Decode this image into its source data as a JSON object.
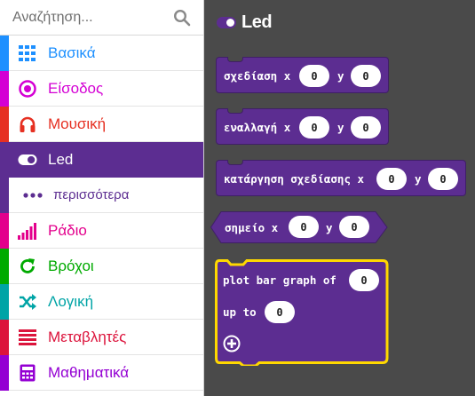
{
  "search": {
    "placeholder": "Αναζήτηση..."
  },
  "colors": {
    "basic": "#1e90ff",
    "input": "#d400d4",
    "music": "#e63022",
    "led": "#5c2d91",
    "radio": "#e3008c",
    "loops": "#00aa00",
    "logic": "#00a4a6",
    "variables": "#dc143c",
    "math": "#9400d3",
    "workspace": "#4a4a4a",
    "selected_outline": "#ffd800"
  },
  "toolbox": {
    "items": [
      {
        "label": "Βασικά",
        "icon": "grid-icon"
      },
      {
        "label": "Είσοδος",
        "icon": "input-circle-icon"
      },
      {
        "label": "Μουσική",
        "icon": "headphones-icon"
      },
      {
        "label": "Led",
        "icon": "toggle-icon"
      },
      {
        "label": "περισσότερα",
        "icon": "more-dots-icon"
      },
      {
        "label": "Ράδιο",
        "icon": "signal-bars-icon"
      },
      {
        "label": "Βρόχοι",
        "icon": "refresh-icon"
      },
      {
        "label": "Λογική",
        "icon": "shuffle-icon"
      },
      {
        "label": "Μεταβλητές",
        "icon": "list-icon"
      },
      {
        "label": "Μαθηματικά",
        "icon": "calculator-icon"
      }
    ]
  },
  "flyout": {
    "title": "Led",
    "blocks": {
      "plot": {
        "label": "σχεδίαση x",
        "y_label": "y",
        "x": "0",
        "y": "0"
      },
      "toggle": {
        "label": "εναλλαγή x",
        "y_label": "y",
        "x": "0",
        "y": "0"
      },
      "unplot": {
        "label": "κατάργηση σχεδίασης x",
        "y_label": "y",
        "x": "0",
        "y": "0"
      },
      "point": {
        "label": "σημείο x",
        "y_label": "y",
        "x": "0",
        "y": "0"
      },
      "bargraph": {
        "label": "plot bar graph of",
        "value": "0",
        "up_to_label": "up to",
        "up_to": "0"
      }
    }
  }
}
